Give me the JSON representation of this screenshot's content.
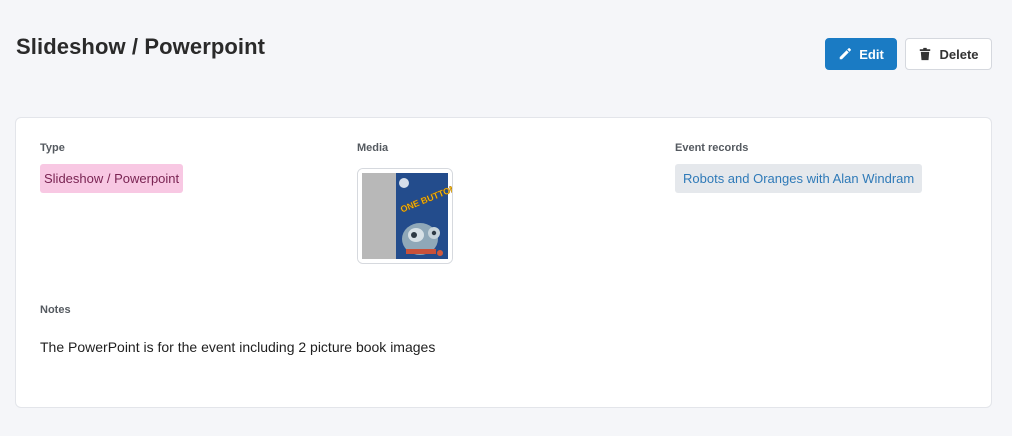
{
  "header": {
    "title": "Slideshow / Powerpoint",
    "edit_label": "Edit",
    "delete_label": "Delete"
  },
  "details": {
    "type_label": "Type",
    "type_value": "Slideshow / Powerpoint",
    "media_label": "Media",
    "media_thumbnail_text": "ONE BUTTON",
    "event_records_label": "Event records",
    "event_records": [
      "Robots and Oranges with Alan Windram"
    ],
    "notes_label": "Notes",
    "notes_value": "The PowerPoint is for the event including 2 picture book images"
  },
  "colors": {
    "primary": "#1a7bc4",
    "type_badge_bg": "#f8c8e3",
    "type_badge_text": "#7a2453",
    "event_chip_bg": "#e5e8ec",
    "event_chip_text": "#2f7ab8"
  },
  "icons": {
    "edit": "pencil-icon",
    "delete": "trash-icon"
  }
}
